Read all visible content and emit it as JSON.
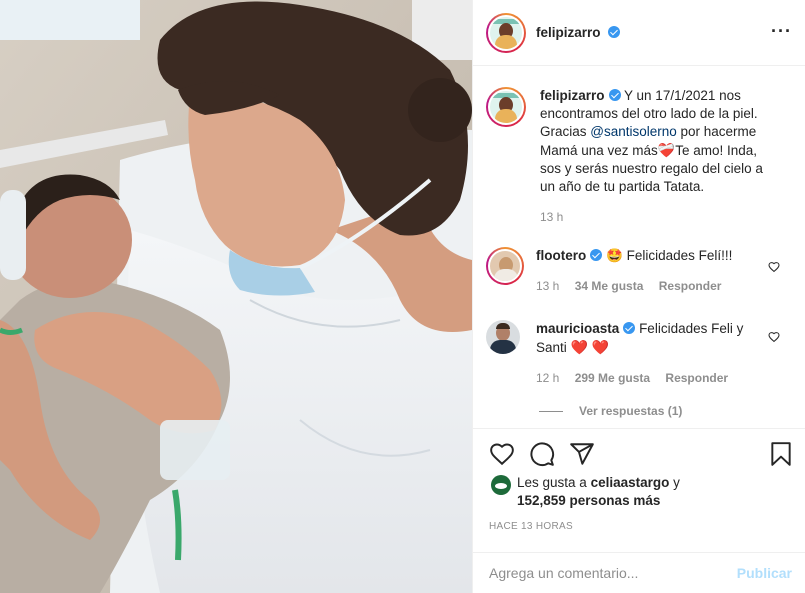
{
  "post": {
    "username": "felipizarro",
    "more_icon": "more-horizontal-icon"
  },
  "caption": {
    "username": "felipizarro",
    "text_part1": "Y un 17/1/2021 nos encontramos del otro lado de la piel. Gracias ",
    "mention": "@santisolerno",
    "text_part2": " por hacerme Mamá una vez más",
    "emoji": "❤️‍🩹",
    "text_part3": "Te amo! Inda, sos y serás nuestro regalo del cielo a un año de tu partida Tatata.",
    "time": "13 h"
  },
  "comments": [
    {
      "username": "flootero",
      "emoji": "🤩",
      "text": "Felicidades Felí!!!",
      "time": "13 h",
      "likes": "34 Me gusta",
      "reply": "Responder"
    },
    {
      "username": "mauricioasta",
      "text": "Felicidades Feli y Santi",
      "hearts": "❤️ ❤️",
      "time": "12 h",
      "likes": "299 Me gusta",
      "reply": "Responder"
    }
  ],
  "view_replies": "Ver respuestas (1)",
  "likes": {
    "prefix": "Les gusta a ",
    "user": "celiaastargo",
    "suffix": " y",
    "count": "152,859 personas más"
  },
  "time_ago": "HACE 13 HORAS",
  "add_comment": {
    "placeholder": "Agrega un comentario...",
    "publish": "Publicar"
  },
  "colors": {
    "verified": "#3897f0",
    "publish_disabled": "#b2dffc",
    "mention": "#00376b",
    "secondary": "#8e8e8e"
  }
}
